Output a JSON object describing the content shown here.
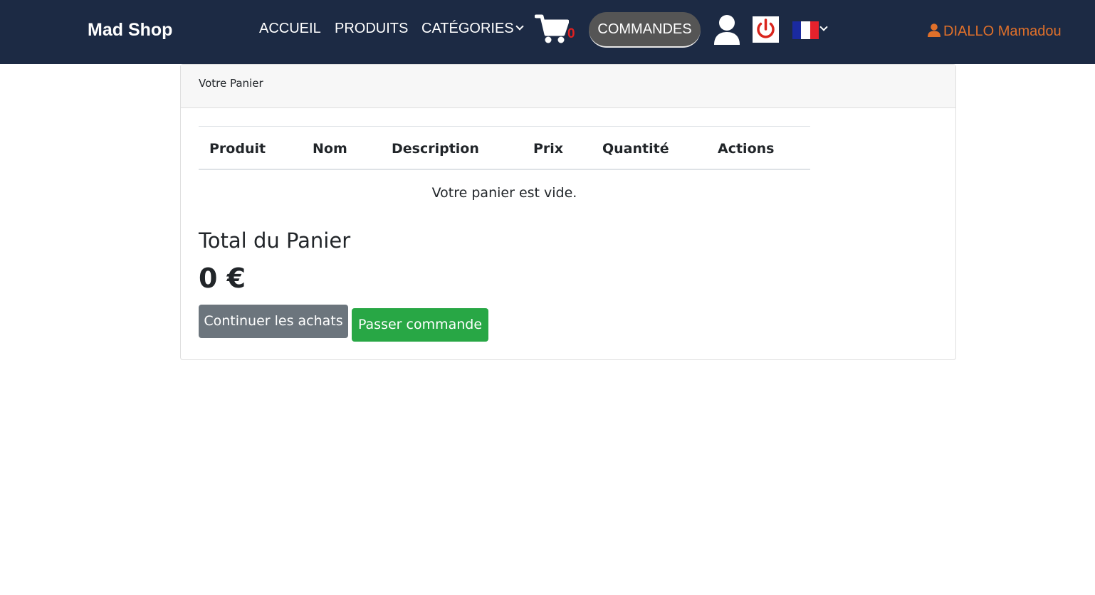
{
  "navbar": {
    "brand": "Mad Shop",
    "links": {
      "accueil": "ACCUEIL",
      "produits": "PRODUITS",
      "categories": "CATÉGORIES"
    },
    "cart_count": "0",
    "commandes": "COMMANDES",
    "user_name": "DIALLO Mamadou",
    "icons": [
      "cart-icon",
      "user-icon",
      "power-icon",
      "flag-fr-icon",
      "chevron-down-icon"
    ],
    "colors": {
      "background": "#1c2a44",
      "cart_badge": "#e02020",
      "user_name": "#e0702a",
      "power": "#d9251d"
    }
  },
  "card": {
    "header": "Votre Panier",
    "table": {
      "columns": [
        "Produit",
        "Nom",
        "Description",
        "Prix",
        "Quantité",
        "Actions"
      ],
      "empty_message": "Votre panier est vide."
    },
    "total_title": "Total du Panier",
    "total_value": "0 €",
    "buttons": {
      "continue": "Continuer les achats",
      "order": "Passer commande"
    },
    "colors": {
      "continue_button": "#6c757d",
      "order_button": "#28a745"
    }
  }
}
